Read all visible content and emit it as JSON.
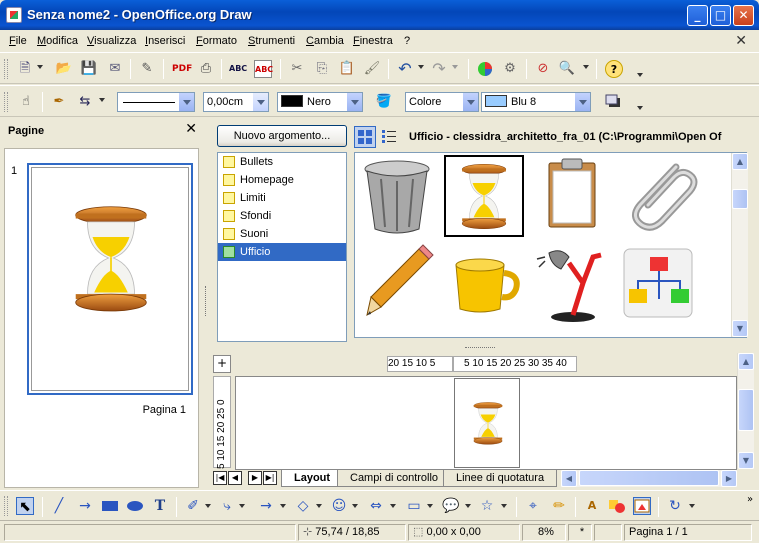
{
  "window": {
    "title": "Senza nome2 - OpenOffice.org Draw",
    "minimize": "_",
    "maximize": "□",
    "close": "✕"
  },
  "menu": {
    "items": [
      "File",
      "Modifica",
      "Visualizza",
      "Inserisci",
      "Formato",
      "Strumenti",
      "Cambia",
      "Finestra",
      "?"
    ],
    "close_doc": "✕"
  },
  "line_props": {
    "line_width": "0,00cm",
    "line_color": {
      "name": "Nero",
      "swatch": "#000000"
    },
    "area_style": "Colore",
    "area_color": {
      "name": "Blu 8",
      "swatch": "#99ccff"
    }
  },
  "pages_pane": {
    "title": "Pagine",
    "close": "✕",
    "pages": [
      {
        "number": "1",
        "label": "Pagina 1"
      }
    ]
  },
  "gallery": {
    "new_theme_button": "Nuovo argomento...",
    "path": "Ufficio - clessidra_architetto_fra_01 (C:\\Programmi\\Open Of",
    "themes": [
      "Bullets",
      "Homepage",
      "Limiti",
      "Sfondi",
      "Suoni",
      "Ufficio"
    ],
    "selected_theme": "Ufficio",
    "items": [
      "trash-can",
      "hourglass",
      "clipboard",
      "paper-clip",
      "pencil",
      "coffee-mug",
      "desk-lamp",
      "org-chart"
    ],
    "selected_item": "hourglass"
  },
  "rulers": {
    "h_left": "20 15 10  5",
    "h_right": "5  10 15 20 25 30 35 40",
    "v": "5  10  15  20  25  0"
  },
  "tabs": [
    "Layout",
    "Campi di controllo",
    "Linee di quotatura"
  ],
  "active_tab": "Layout",
  "status": {
    "position": "75,74 / 18,85",
    "size": "0,00 x 0,00",
    "zoom": "8%",
    "modified": "*",
    "page": "Pagina 1 / 1"
  },
  "colors": {
    "selection": "#316ac5",
    "titlebar": "#0a5fd8",
    "chrome": "#ece9d8"
  }
}
